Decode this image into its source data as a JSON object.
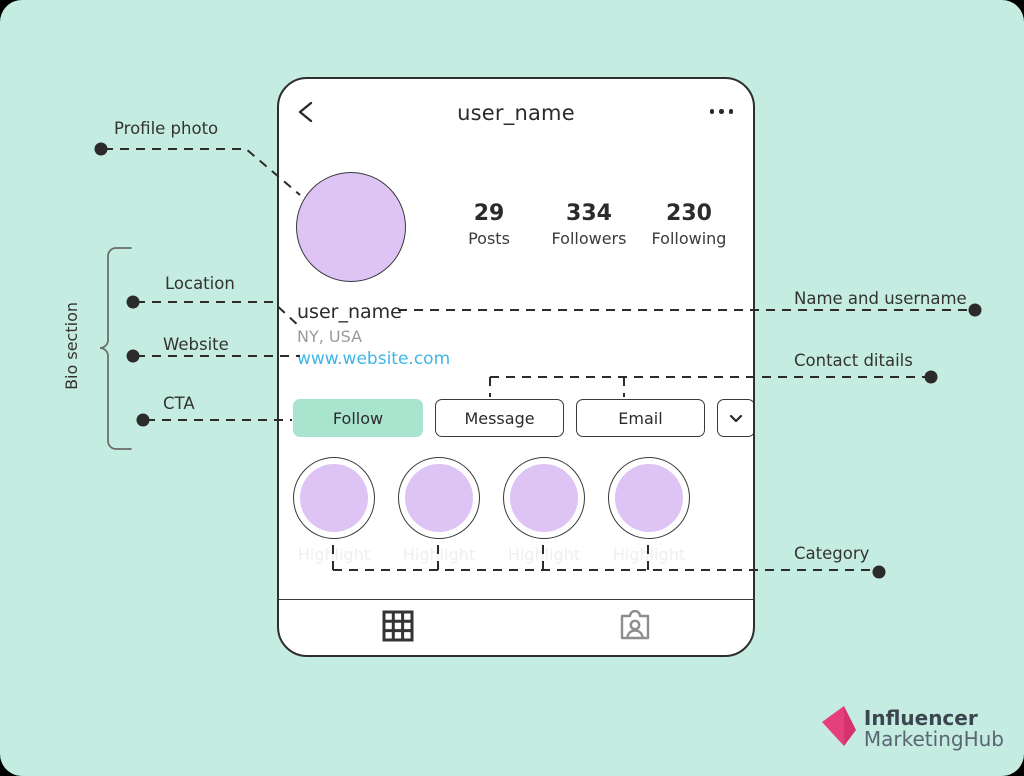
{
  "meta": {
    "background_color": "#c5ece0",
    "accent_mint": "#a9e4cf",
    "avatar_purple": "#ddc4f5",
    "link_blue": "#3fb5e8",
    "logo_pink": "#e5407b"
  },
  "phone": {
    "header": {
      "back_icon": "chevron-left-icon",
      "title": "user_name",
      "menu_icon": "three-dots-icon"
    },
    "avatar": {
      "icon": "profile-photo-placeholder"
    },
    "stats": [
      {
        "value": "29",
        "label": "Posts"
      },
      {
        "value": "334",
        "label": "Followers"
      },
      {
        "value": "230",
        "label": "Following"
      }
    ],
    "bio": {
      "name": "user_name",
      "location": "NY, USA",
      "website": "www.website.com"
    },
    "actions": [
      {
        "label": "Follow",
        "style": "filled"
      },
      {
        "label": "Message",
        "style": "outline"
      },
      {
        "label": "Email",
        "style": "outline"
      }
    ],
    "more_button": {
      "icon": "chevron-down-icon"
    },
    "highlights": [
      {
        "label": "Highlight"
      },
      {
        "label": "Highlight"
      },
      {
        "label": "Highlight"
      },
      {
        "label": "Highlight"
      }
    ],
    "navbar": [
      {
        "icon": "grid-icon",
        "active": true
      },
      {
        "icon": "tagged-user-icon",
        "active": false
      }
    ]
  },
  "annotations": {
    "left": [
      {
        "label": "Profile photo"
      },
      {
        "label": "Location"
      },
      {
        "label": "Website"
      },
      {
        "label": "CTA"
      }
    ],
    "bracket_label": "Bio section",
    "right": [
      {
        "label": "Name and username"
      },
      {
        "label": "Contact ditails"
      },
      {
        "label": "Category"
      }
    ]
  },
  "logo": {
    "line1": "Influencer",
    "line2_a": "Marketing",
    "line2_b": "Hub"
  }
}
